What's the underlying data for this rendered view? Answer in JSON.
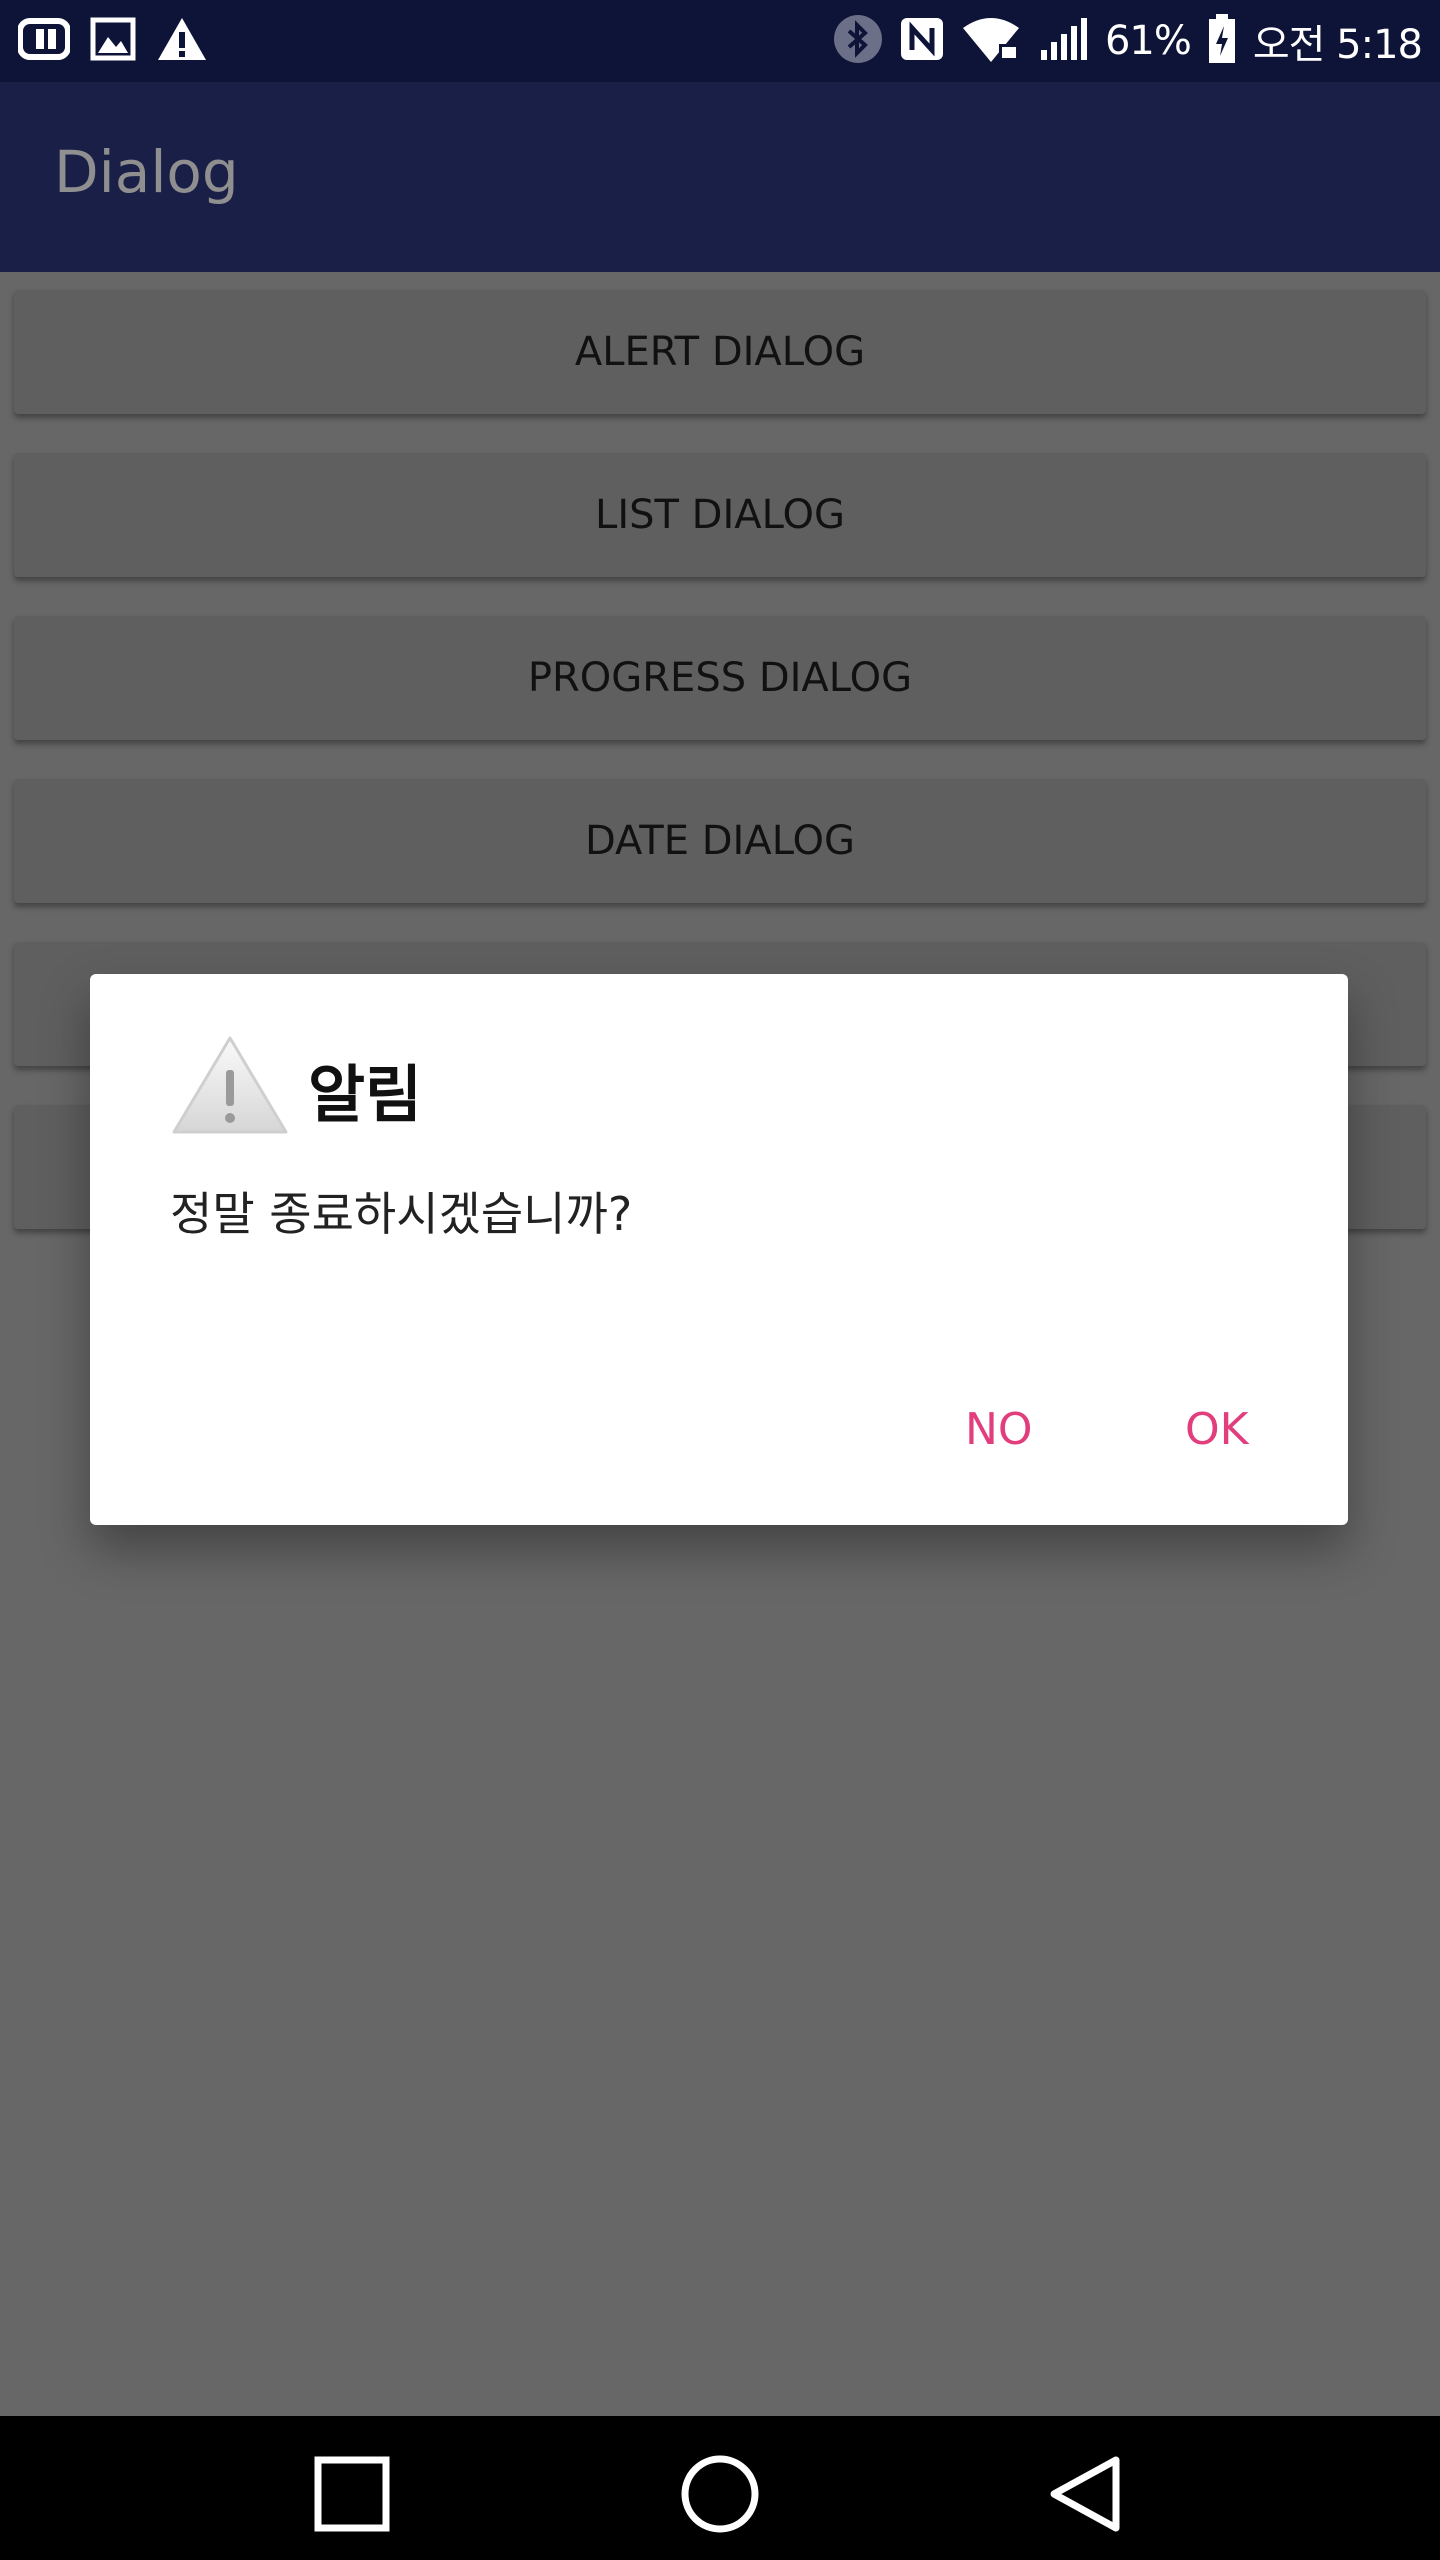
{
  "status_bar": {
    "left_icons": [
      "uplus-icon",
      "image-icon",
      "warning-icon"
    ],
    "right_icons": [
      "bluetooth-icon",
      "nfc-icon",
      "wifi-lock-icon",
      "signal-icon"
    ],
    "battery": "61%",
    "time": "오전 5:18"
  },
  "app_bar": {
    "title": "Dialog"
  },
  "buttons": [
    {
      "label": "ALERT DIALOG"
    },
    {
      "label": "LIST DIALOG"
    },
    {
      "label": "PROGRESS DIALOG"
    },
    {
      "label": "DATE DIALOG"
    },
    {
      "label": ""
    },
    {
      "label": ""
    }
  ],
  "dialog": {
    "icon": "warning-icon",
    "title": "알림",
    "message": "정말 종료하시겠습니까?",
    "negative_label": "NO",
    "positive_label": "OK",
    "accent_color": "#e23d7d"
  },
  "nav_bar": {
    "icons": [
      "recents-icon",
      "home-icon",
      "back-icon"
    ]
  }
}
